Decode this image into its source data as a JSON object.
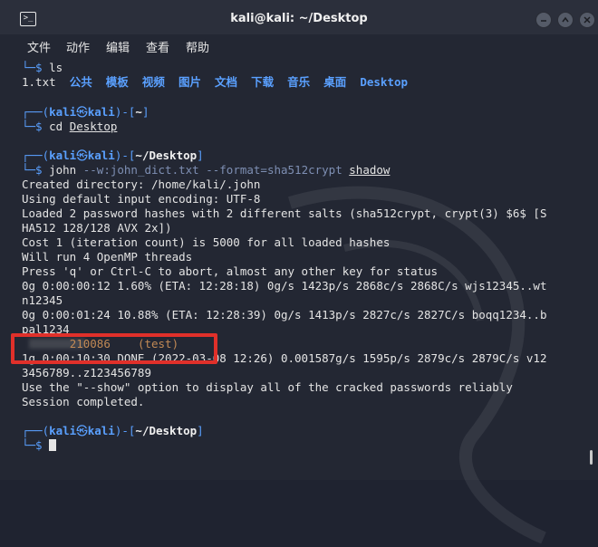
{
  "window": {
    "title": "kali@kali: ~/Desktop"
  },
  "menu": {
    "file": "文件",
    "action": "动作",
    "edit": "编辑",
    "view": "查看",
    "help": "帮助"
  },
  "term": {
    "l0_prompt": "└─$",
    "l0_cmd": "ls",
    "ls_items": [
      "1.txt",
      "公共",
      "模板",
      "视频",
      "图片",
      "文档",
      "下载",
      "音乐",
      "桌面",
      "Desktop"
    ],
    "p1_corner": "┌──(",
    "p1_user": "kali",
    "p1_at": "㉿",
    "p1_host": "kali",
    "p1_mid": ")-[",
    "p1_dir": "~",
    "p1_end": "]",
    "p1_prompt": "└─$",
    "p1_cmd": "cd",
    "p1_arg": "Desktop",
    "p2_corner": "┌──(",
    "p2_user": "kali",
    "p2_at": "㉿",
    "p2_host": "kali",
    "p2_mid": ")-[",
    "p2_dir": "~/Desktop",
    "p2_end": "]",
    "p2_prompt": "└─$",
    "p2_cmd": "john",
    "p2_opt1": "--w:john_dict.txt",
    "p2_opt2": "--format=sha512crypt",
    "p2_arg": "shadow",
    "out": [
      "Created directory: /home/kali/.john",
      "Using default input encoding: UTF-8",
      "Loaded 2 password hashes with 2 different salts (sha512crypt, crypt(3) $6$ [S",
      "HA512 128/128 AVX 2x])",
      "Cost 1 (iteration count) is 5000 for all loaded hashes",
      "Will run 4 OpenMP threads",
      "Press 'q' or Ctrl-C to abort, almost any other key for status",
      "0g 0:00:00:12 1.60% (ETA: 12:28:18) 0g/s 1423p/s 2868c/s 2868C/s wjs12345..wt",
      "n12345",
      "0g 0:00:01:24 10.88% (ETA: 12:28:39) 0g/s 1413p/s 2827c/s 2827C/s boqq1234..b",
      "pal1234"
    ],
    "crack_pw_tail": "210086",
    "crack_user": "(test)",
    "done1": "1g 0:00:10:30 DONE (2022-03-08 12:26) 0.001587g/s 1595p/s 2879c/s 2879C/s v12",
    "done2": "3456789..z123456789",
    "show_hint": "Use the \"--show\" option to display all of the cracked passwords reliably",
    "session": "Session completed.",
    "p3_corner": "┌──(",
    "p3_user": "kali",
    "p3_at": "㉿",
    "p3_host": "kali",
    "p3_mid": ")-[",
    "p3_dir": "~/Desktop",
    "p3_end": "]",
    "p3_prompt": "└─$"
  },
  "colors": {
    "prompt_blue": "#5aa0ff",
    "highlight_red": "#e0302a",
    "bg": "#232733"
  }
}
